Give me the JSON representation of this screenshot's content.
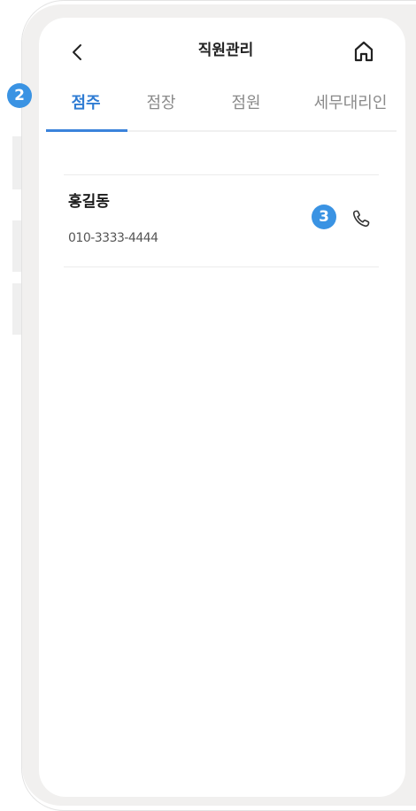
{
  "header": {
    "title": "직원관리",
    "back_icon": "chevron-left-icon",
    "home_icon": "home-icon"
  },
  "annotations": {
    "tabs_marker": "2",
    "call_marker": "3",
    "marker_color": "#3a93e3"
  },
  "tabs": [
    {
      "label": "점주",
      "active": true
    },
    {
      "label": "점장",
      "active": false
    },
    {
      "label": "점원",
      "active": false
    },
    {
      "label": "세무대리인",
      "active": false
    }
  ],
  "contacts": [
    {
      "name": "홍길동",
      "phone": "010-3333-4444",
      "call_icon": "phone-icon"
    }
  ],
  "colors": {
    "accent": "#2f7cd3",
    "inactive_tab": "#8a8a8a",
    "frame": "#f1f0ef"
  }
}
